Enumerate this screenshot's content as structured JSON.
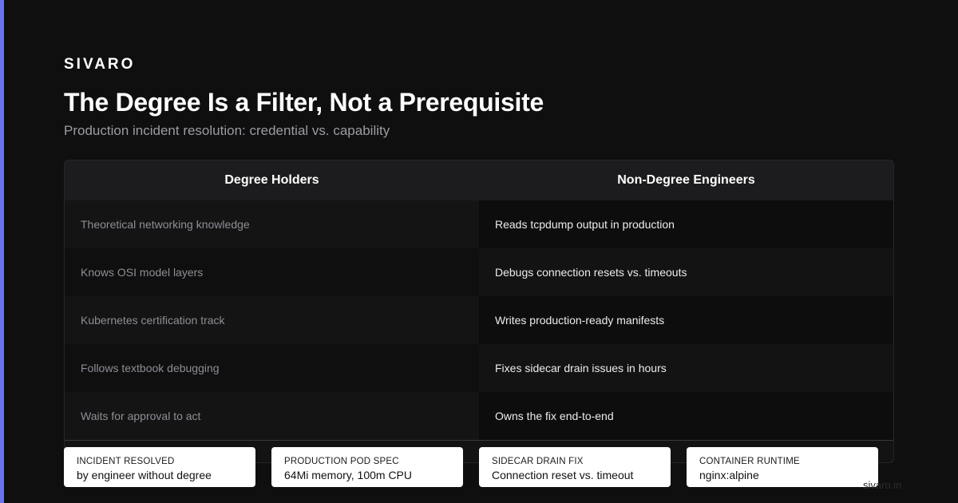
{
  "accent_color": "#6b72f0",
  "brand": "SIVARO",
  "title": "The Degree Is a Filter, Not a Prerequisite",
  "subtitle": "Production incident resolution: credential vs. capability",
  "table": {
    "headers": [
      "Degree Holders",
      "Non-Degree Engineers"
    ],
    "rows": [
      [
        "Theoretical networking knowledge",
        "Reads tcpdump output in production"
      ],
      [
        "Knows OSI model layers",
        "Debugs connection resets vs. timeouts"
      ],
      [
        "Kubernetes certification track",
        "Writes production-ready manifests"
      ],
      [
        "Follows textbook debugging",
        "Fixes sidecar drain issues in hours"
      ],
      [
        "Waits for approval to act",
        "Owns the fix end-to-end"
      ]
    ]
  },
  "stats": [
    {
      "label": "Incident resolved",
      "value": "by engineer without degree"
    },
    {
      "label": "Production pod spec",
      "value": "64Mi memory, 100m CPU"
    },
    {
      "label": "Sidecar drain fix",
      "value": "Connection reset vs. timeout"
    },
    {
      "label": "Container runtime",
      "value": "nginx:alpine"
    }
  ],
  "footer_url": "sivaro.in"
}
